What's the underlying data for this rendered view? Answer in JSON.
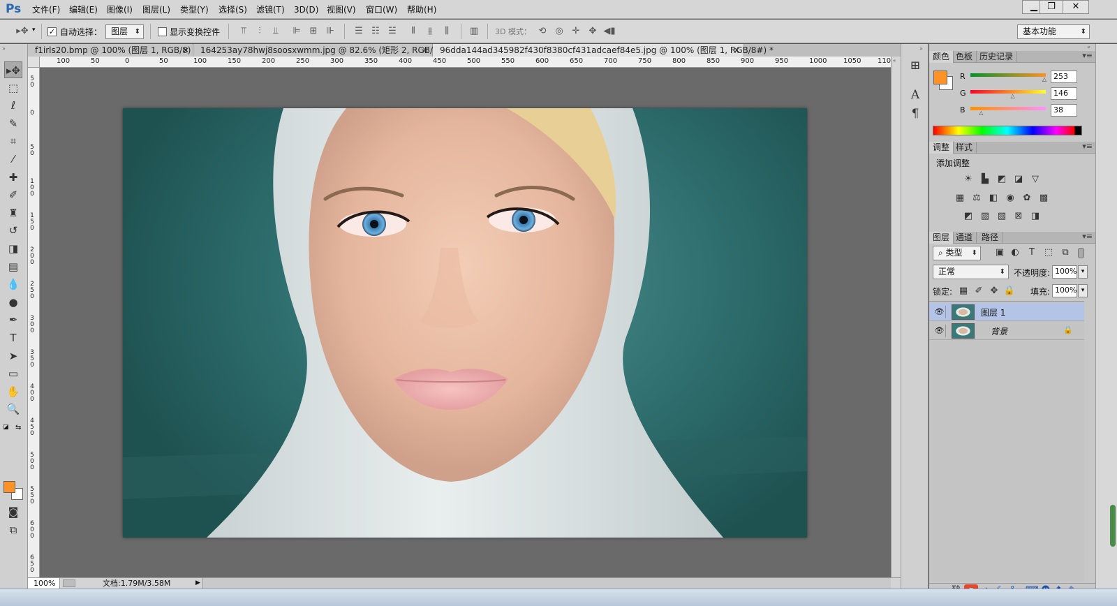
{
  "app": {
    "logo": "Ps"
  },
  "menu": [
    "文件(F)",
    "编辑(E)",
    "图像(I)",
    "图层(L)",
    "类型(Y)",
    "选择(S)",
    "滤镜(T)",
    "3D(D)",
    "视图(V)",
    "窗口(W)",
    "帮助(H)"
  ],
  "window_controls": {
    "minimize": "▁",
    "restore": "❐",
    "close": "✕"
  },
  "options": {
    "auto_select_label": "自动选择：",
    "auto_select_checked": "✓",
    "auto_select_target": "图层",
    "show_transform_label": "显示变换控件",
    "mode_3d_label": "3D 模式：",
    "workspace": "基本功能"
  },
  "tabs": [
    {
      "label": "f1irls20.bmp @ 100% (图层 1, RGB/8) *",
      "close": "×"
    },
    {
      "label": "164253ay78hwj8soosxwmm.jpg @ 82.6% (矩形 2, RGB/8) *",
      "close": "×"
    },
    {
      "label": "96dda144ad345982f430f8380cf431adcaef84e5.jpg @ 100% (图层 1, RGB/8#) *",
      "close": "×"
    }
  ],
  "ruler": {
    "h_ticks": [
      "100",
      "50",
      "0",
      "50",
      "100",
      "150",
      "200",
      "250",
      "300",
      "350",
      "400",
      "450",
      "500",
      "550",
      "600",
      "650",
      "700",
      "750",
      "800",
      "850",
      "900",
      "950",
      "1000",
      "1050",
      "1100"
    ],
    "v_ticks": [
      "5 0",
      "0",
      "5 0",
      "1 0 0",
      "1 5 0",
      "2 0 0",
      "2 5 0",
      "3 0 0",
      "3 5 0",
      "4 0 0",
      "4 5 0",
      "5 0 0",
      "5 5 0",
      "6 0 0",
      "6 5 0"
    ]
  },
  "status": {
    "zoom": "100%",
    "doc": "文档:1.79M/3.58M",
    "arrow": "▶"
  },
  "tools": [
    {
      "name": "move-tool",
      "glyph": "▸✥"
    },
    {
      "name": "marquee-tool",
      "glyph": "⬚"
    },
    {
      "name": "lasso-tool",
      "glyph": "ℓ"
    },
    {
      "name": "quick-select-tool",
      "glyph": "✎"
    },
    {
      "name": "crop-tool",
      "glyph": "⌗"
    },
    {
      "name": "eyedropper-tool",
      "glyph": "⁄"
    },
    {
      "name": "healing-tool",
      "glyph": "✚"
    },
    {
      "name": "brush-tool",
      "glyph": "✐"
    },
    {
      "name": "stamp-tool",
      "glyph": "♜"
    },
    {
      "name": "history-brush-tool",
      "glyph": "↺"
    },
    {
      "name": "eraser-tool",
      "glyph": "◨"
    },
    {
      "name": "gradient-tool",
      "glyph": "▤"
    },
    {
      "name": "blur-tool",
      "glyph": "💧"
    },
    {
      "name": "dodge-tool",
      "glyph": "●"
    },
    {
      "name": "pen-tool",
      "glyph": "✒"
    },
    {
      "name": "type-tool",
      "glyph": "T"
    },
    {
      "name": "path-select-tool",
      "glyph": "➤"
    },
    {
      "name": "rectangle-tool",
      "glyph": "▭"
    },
    {
      "name": "hand-tool",
      "glyph": "✋"
    },
    {
      "name": "zoom-tool",
      "glyph": "🔍"
    }
  ],
  "colors": {
    "foreground": "#fd9226",
    "background": "#ffffff",
    "accent": "#b4c4e6"
  },
  "color_panel": {
    "tabs": [
      "颜色",
      "色板",
      "历史记录"
    ],
    "channels": [
      {
        "label": "R",
        "value": "253",
        "fraction": 0.99
      },
      {
        "label": "G",
        "value": "146",
        "fraction": 0.57
      },
      {
        "label": "B",
        "value": "38",
        "fraction": 0.15
      }
    ]
  },
  "adjust_panel": {
    "tabs": [
      "调整",
      "样式"
    ],
    "title": "添加调整"
  },
  "layers_panel": {
    "tabs": [
      "图层",
      "通道",
      "路径"
    ],
    "filter": "类型",
    "blend_mode": "正常",
    "opacity_label": "不透明度:",
    "opacity": "100%",
    "lock_label": "锁定:",
    "fill_label": "填充:",
    "fill": "100%",
    "layers": [
      {
        "name": "图层 1",
        "eye": "👁",
        "selected": true
      },
      {
        "name": "背景",
        "eye": "👁",
        "lock": "🔒",
        "selected": false
      }
    ]
  },
  "tray": {
    "ime": "S",
    "ime_mode": "中"
  }
}
